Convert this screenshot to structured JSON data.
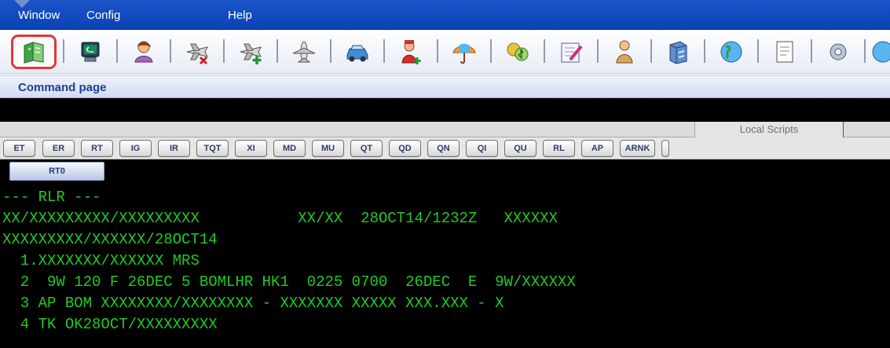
{
  "menubar": {
    "items": [
      {
        "label": "Window"
      },
      {
        "label": "Config"
      },
      {
        "label": "Help"
      }
    ]
  },
  "toolbar": {
    "icons": [
      {
        "name": "book-icon",
        "active": true
      },
      {
        "name": "terminal-screen-icon"
      },
      {
        "name": "customer-profile-icon"
      },
      {
        "name": "plane-remove-icon"
      },
      {
        "name": "plane-add-icon"
      },
      {
        "name": "aircraft-icon"
      },
      {
        "name": "car-icon"
      },
      {
        "name": "hotel-staff-icon"
      },
      {
        "name": "umbrella-icon"
      },
      {
        "name": "money-icon"
      },
      {
        "name": "notes-edit-icon"
      },
      {
        "name": "person-icon"
      },
      {
        "name": "file-cabinet-icon"
      },
      {
        "name": "globe-icon"
      }
    ]
  },
  "page": {
    "title": "Command page"
  },
  "scripts": {
    "local_tab": "Local Scripts"
  },
  "commands": [
    "ET",
    "ER",
    "RT",
    "IG",
    "IR",
    "TQT",
    "XI",
    "MD",
    "MU",
    "QT",
    "QD",
    "QN",
    "QI",
    "QU",
    "RL",
    "AP",
    "ARNK"
  ],
  "terminal": {
    "tab_label": "RT0",
    "lines": [
      "--- RLR ---",
      "XX/XXXXXXXXX/XXXXXXXXX           XX/XX  28OCT14/1232Z   XXXXXX",
      "XXXXXXXXX/XXXXXX/28OCT14",
      "  1.XXXXXXX/XXXXXX MRS",
      "  2  9W 120 F 26DEC 5 BOMLHR HK1  0225 0700  26DEC  E  9W/XXXXXX",
      "  3 AP BOM XXXXXXXX/XXXXXXXX - XXXXXXX XXXXX XXX.XXX - X",
      "  4 TK OK28OCT/XXXXXXXXX"
    ]
  },
  "colors": {
    "menubar": "#0b43b5",
    "terminal_bg": "#000000",
    "terminal_text": "#1fcb24",
    "highlight": "#e23636"
  }
}
